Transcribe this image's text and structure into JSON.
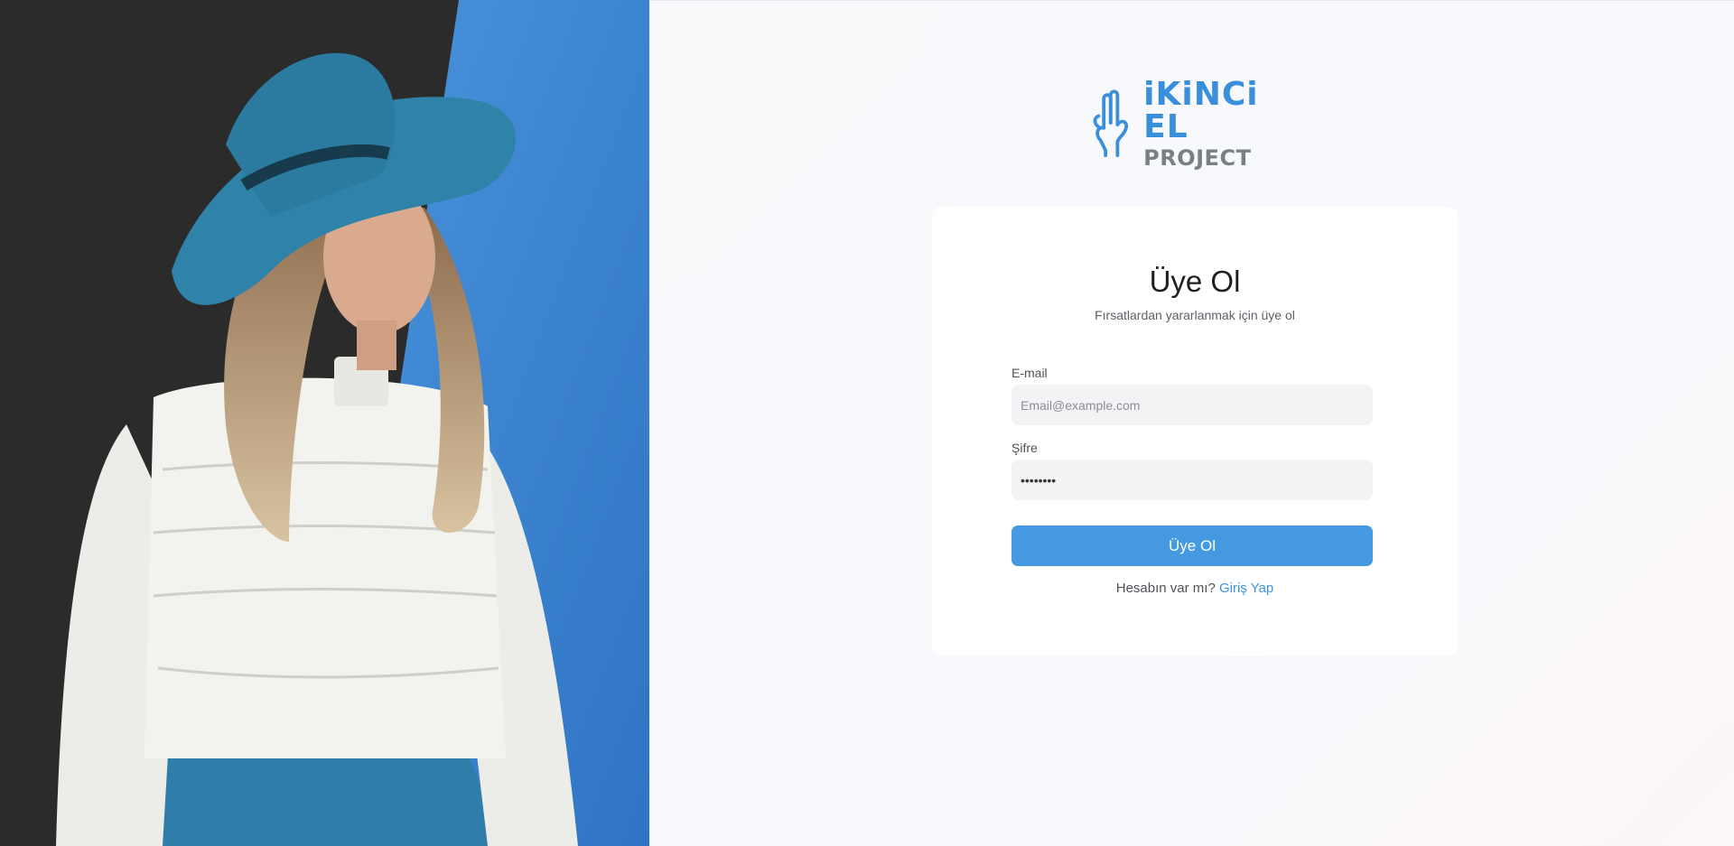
{
  "brand": {
    "name": "iKiNCi EL",
    "subtitle": "PROJECT",
    "icon": "two-fingers-hand-icon",
    "accent": "#3a8fdc"
  },
  "hero": {
    "image": "woman-in-blue-hat-photo",
    "background_dark": "#2b2b2b",
    "background_blue": "#3f8ad6"
  },
  "form": {
    "title": "Üye Ol",
    "subtitle": "Fırsatlardan yararlanmak için üye ol",
    "email": {
      "label": "E-mail",
      "placeholder": "Email@example.com",
      "value": ""
    },
    "password": {
      "label": "Şifre",
      "value": "••••••••"
    },
    "submit_label": "Üye Ol",
    "footer_text": "Hesabın var mı?",
    "footer_link": "Giriş Yap",
    "button_color": "#4599e0"
  }
}
